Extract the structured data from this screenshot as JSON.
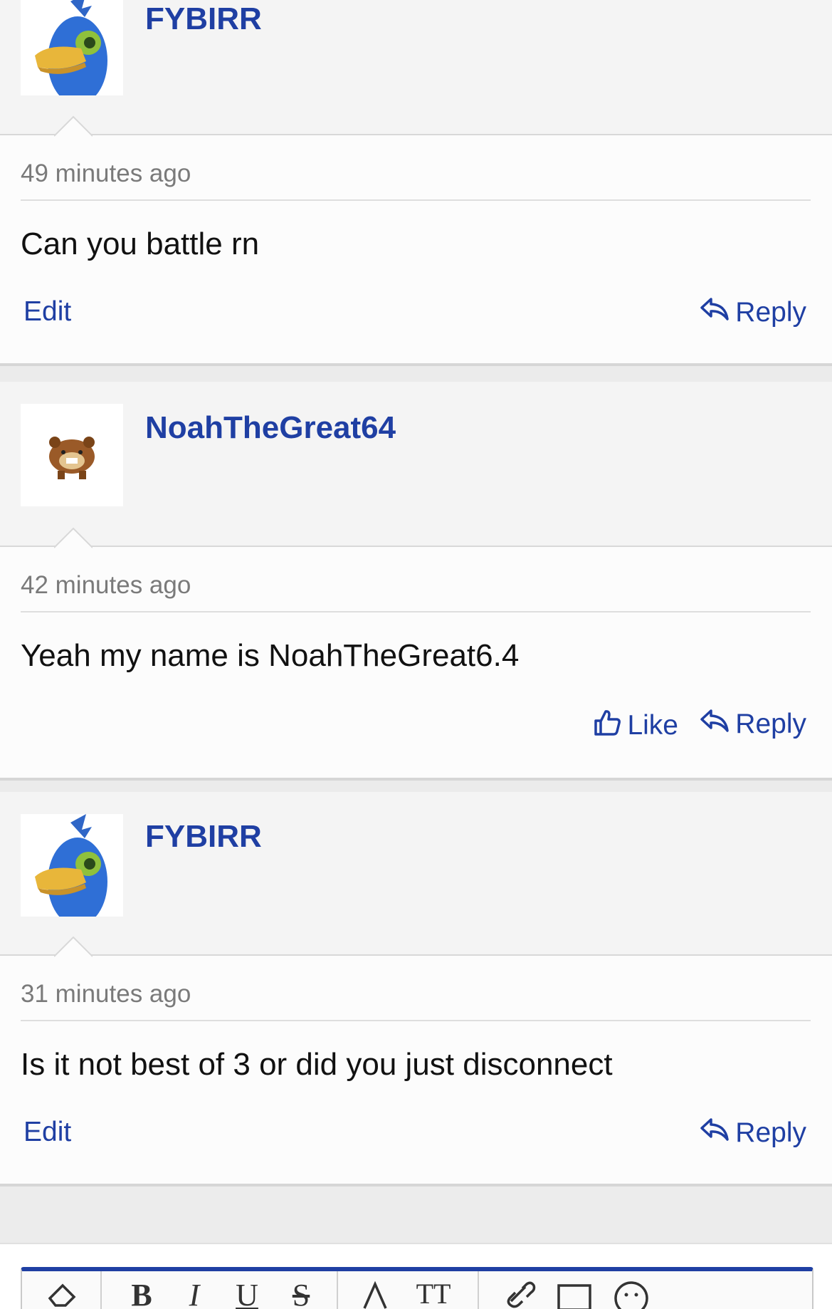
{
  "comments": [
    {
      "username": "FYBIRR",
      "avatar": "duck-avatar",
      "timestamp": "49 minutes ago",
      "text": "Can you battle rn",
      "actions": {
        "edit": "Edit",
        "reply": "Reply"
      }
    },
    {
      "username": "NoahTheGreat64",
      "avatar": "bear-avatar",
      "timestamp": "42 minutes ago",
      "text": "Yeah my name is NoahTheGreat6.4",
      "actions": {
        "like": "Like",
        "reply": "Reply"
      }
    },
    {
      "username": "FYBIRR",
      "avatar": "duck-avatar",
      "timestamp": "31 minutes ago",
      "text": "Is it not best of 3 or did you just disconnect",
      "actions": {
        "edit": "Edit",
        "reply": "Reply"
      }
    }
  ],
  "toolbar": {
    "tools": [
      "eraser-icon",
      "bold-icon",
      "italic-icon",
      "underline-icon",
      "strikethrough-icon",
      "text-color-icon",
      "text-size-icon",
      "link-icon",
      "image-icon",
      "emoji-icon"
    ]
  },
  "colors": {
    "accent": "#1f3fa3",
    "text": "#111111",
    "muted": "#7a7a7a",
    "header_bg": "#f4f4f4",
    "body_bg": "#fcfcfc"
  }
}
